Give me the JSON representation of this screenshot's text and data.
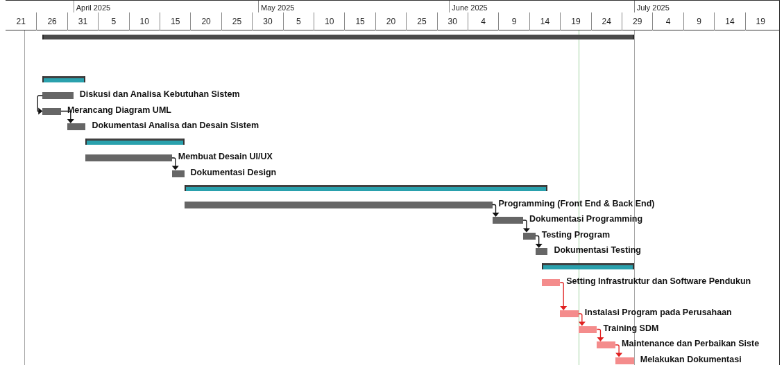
{
  "timescale": {
    "months": [
      "April 2025",
      "May 2025",
      "June 2025",
      "July 2025"
    ],
    "days": [
      "21",
      "26",
      "31",
      "5",
      "10",
      "15",
      "20",
      "25",
      "30",
      "5",
      "10",
      "15",
      "20",
      "25",
      "30",
      "4",
      "9",
      "14",
      "19",
      "24",
      "29",
      "4",
      "9",
      "14",
      "19"
    ]
  },
  "rows": [
    {
      "kind": "project_summary"
    },
    {
      "kind": "blank"
    },
    {
      "kind": "blank"
    },
    {
      "kind": "summary"
    },
    {
      "kind": "task",
      "label": "Diskusi dan Analisa Kebutuhan Sistem",
      "linked": false
    },
    {
      "kind": "task",
      "label": "Merancang Diagram UML",
      "linked": true
    },
    {
      "kind": "task",
      "label": "Dokumentasi Analisa dan Desain Sistem",
      "linked": true
    },
    {
      "kind": "summary"
    },
    {
      "kind": "task",
      "label": "Membuat Desain UI/UX",
      "linked": false
    },
    {
      "kind": "task",
      "label": "Dokumentasi Design",
      "linked": true
    },
    {
      "kind": "summary"
    },
    {
      "kind": "task",
      "label": "Programming (Front End & Back End)",
      "linked": false
    },
    {
      "kind": "task",
      "label": "Dokumentasi Programming",
      "linked": true
    },
    {
      "kind": "task",
      "label": "Testing Program",
      "linked": true
    },
    {
      "kind": "task",
      "label": "Dokumentasi Testing",
      "linked": true
    },
    {
      "kind": "summary"
    },
    {
      "kind": "critical",
      "label": "Setting Infrastruktur dan Software Pendukun",
      "linked": false
    },
    {
      "kind": "blank"
    },
    {
      "kind": "critical",
      "label": "Instalasi Program pada Perusahaan",
      "linked": true
    },
    {
      "kind": "critical",
      "label": "Training SDM",
      "linked": true
    },
    {
      "kind": "critical",
      "label": "Maintenance dan Perbaikan Siste",
      "linked": true
    },
    {
      "kind": "critical",
      "label": "Melakukan Dokumentasi",
      "linked": true
    }
  ]
}
